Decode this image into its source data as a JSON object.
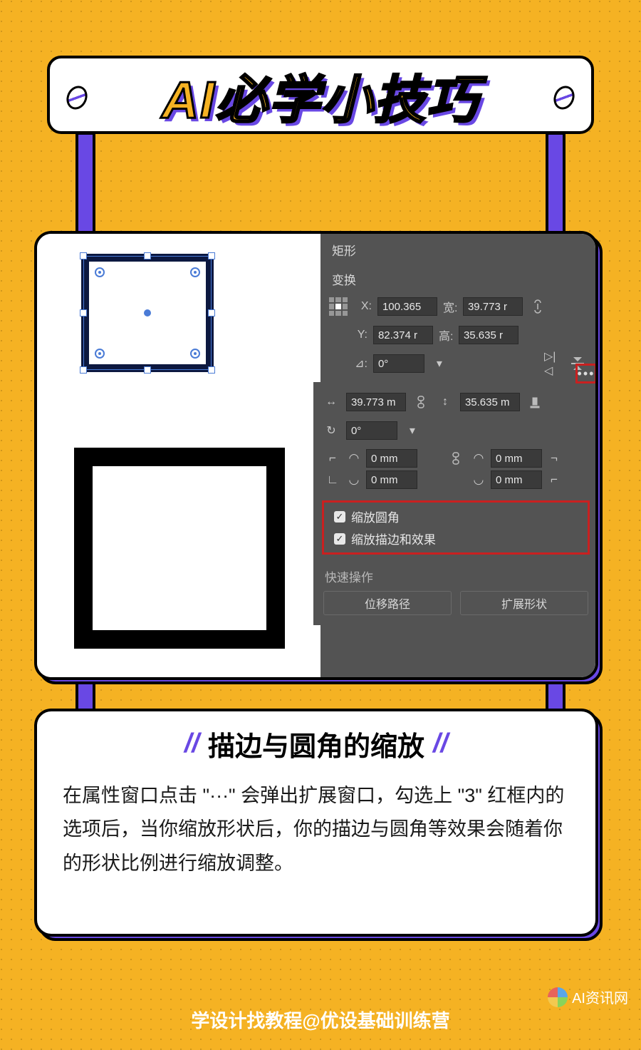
{
  "header": {
    "title": "AI必学小技巧"
  },
  "panel": {
    "shape_title": "矩形",
    "transform_title": "变换",
    "x_label": "X:",
    "x_value": "100.365",
    "w_label": "宽:",
    "w_value": "39.773 r",
    "y_label": "Y:",
    "y_value": "82.374 r",
    "h_label": "高:",
    "h_value": "35.635 r",
    "angle_label": "⊿:",
    "angle_value": "0°"
  },
  "popup": {
    "w_value": "39.773 m",
    "h_value": "35.635 m",
    "rotate_value": "0°",
    "corner_tl": "0 mm",
    "corner_tr": "0 mm",
    "corner_bl": "0 mm",
    "corner_br": "0 mm",
    "scale_corners": "缩放圆角",
    "scale_strokes": "缩放描边和效果"
  },
  "quick_actions": {
    "title": "快速操作",
    "offset_path": "位移路径",
    "expand_shape": "扩展形状"
  },
  "description": {
    "title": "描边与圆角的缩放",
    "body": "在属性窗口点击 \"···\" 会弹出扩展窗口，勾选上 \"3\" 红框内的选项后，当你缩放形状后，你的描边与圆角等效果会随着你的形状比例进行缩放调整。"
  },
  "footer": {
    "text": "学设计找教程@优设基础训练营"
  },
  "watermark": {
    "text": "AI资讯网"
  }
}
